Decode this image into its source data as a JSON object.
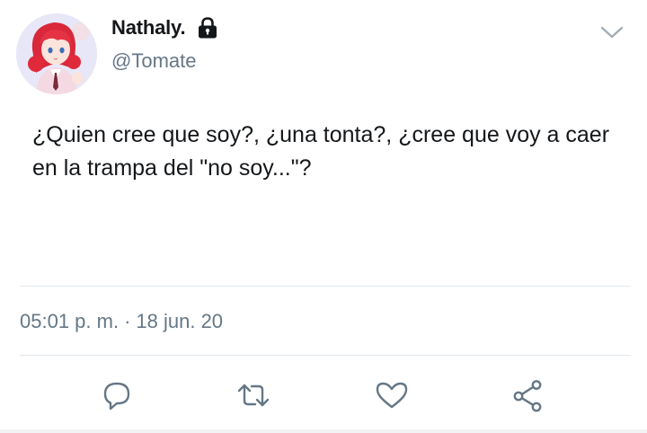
{
  "user": {
    "display_name": "Nathaly.",
    "handle": "@Tomate",
    "protected_icon": "lock-icon",
    "avatar": "anime-girl-red-hair"
  },
  "menu": {
    "icon": "chevron-down-icon"
  },
  "tweet": {
    "text": "¿Quien cree que soy?, ¿una tonta?, ¿cree que voy a caer en la trampa del \"no soy...\"?",
    "time": "05:01 p. m.",
    "separator": "·",
    "date": "18 jun. 20"
  },
  "actions": [
    {
      "name": "reply",
      "icon": "comment-icon"
    },
    {
      "name": "retweet",
      "icon": "retweet-icon"
    },
    {
      "name": "like",
      "icon": "heart-icon"
    },
    {
      "name": "share",
      "icon": "share-icon"
    }
  ],
  "colors": {
    "text": "#14171a",
    "secondary": "#657786",
    "divider": "#e1e8ed"
  }
}
